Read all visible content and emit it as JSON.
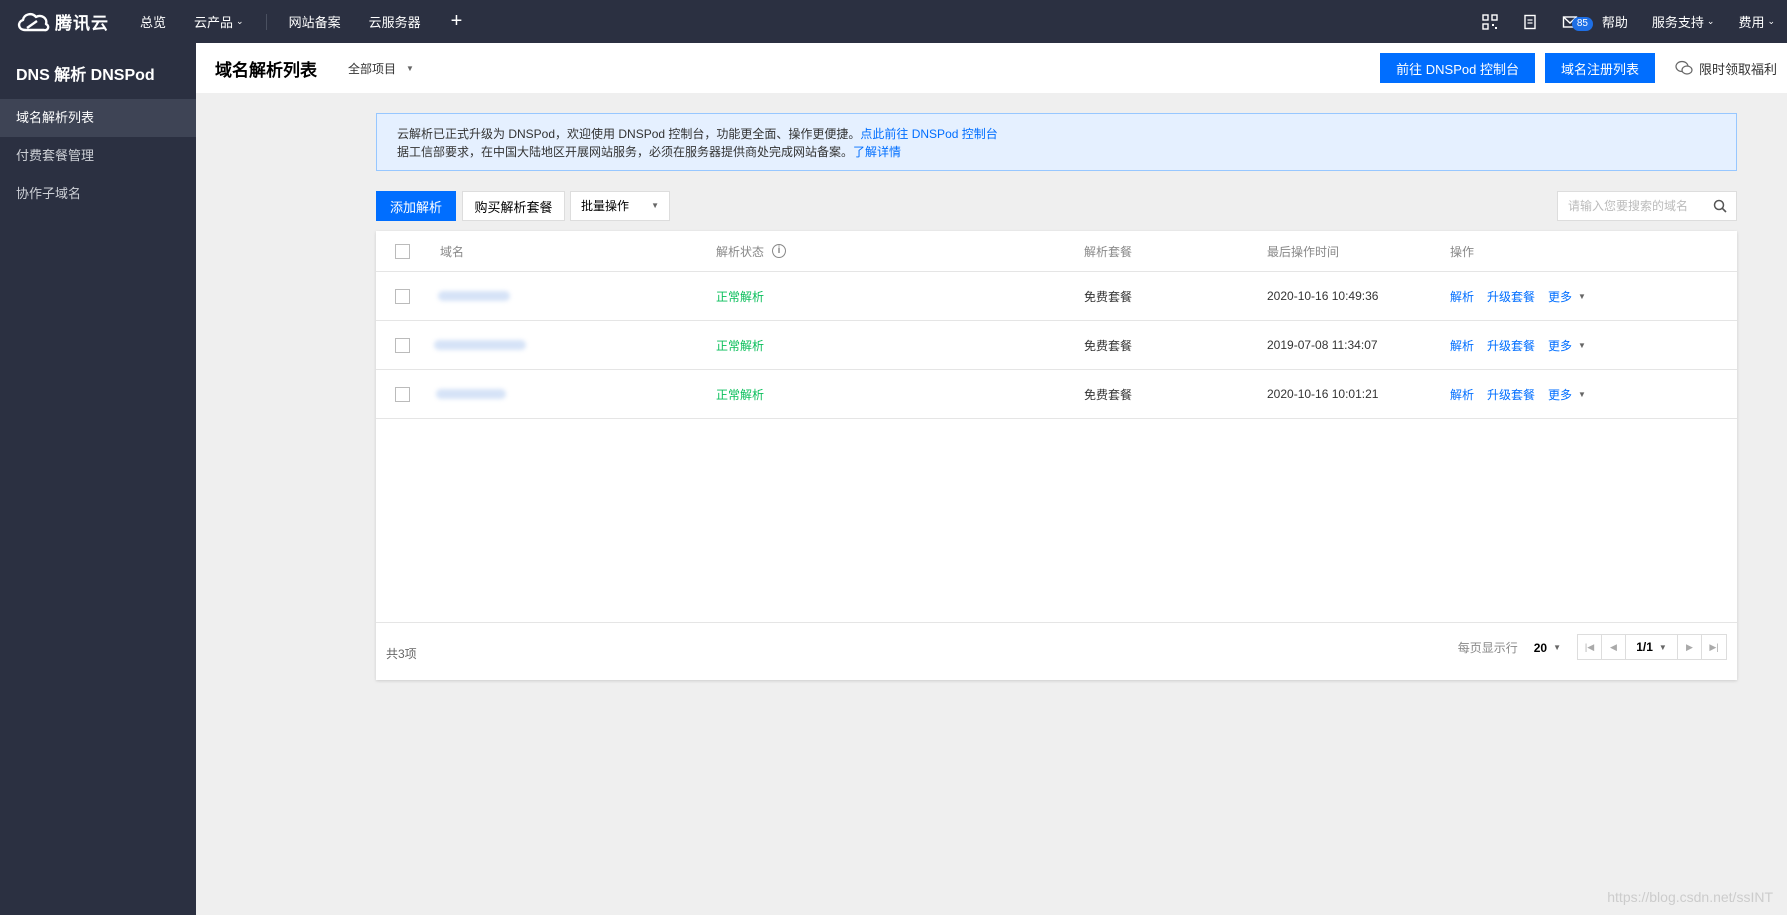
{
  "topbar": {
    "brand": "腾讯云",
    "nav": [
      "总览",
      "云产品",
      "网站备案",
      "云服务器"
    ],
    "plus": "+",
    "badge_count": "85",
    "help": "帮助",
    "support": "服务支持",
    "billing": "费用"
  },
  "sidebar": {
    "title": "DNS 解析 DNSPod",
    "items": [
      {
        "label": "域名解析列表"
      },
      {
        "label": "付费套餐管理"
      },
      {
        "label": "协作子域名"
      }
    ]
  },
  "header": {
    "title": "域名解析列表",
    "project": "全部项目",
    "btn_dnspod": "前往 DNSPod 控制台",
    "btn_register": "域名注册列表",
    "welfare": "限时领取福利"
  },
  "notice": {
    "line1": "云解析已正式升级为 DNSPod，欢迎使用 DNSPod 控制台，功能更全面、操作更便捷。",
    "line1_link": "点此前往 DNSPod 控制台",
    "line2": "据工信部要求，在中国大陆地区开展网站服务，必须在服务器提供商处完成网站备案。",
    "line2_link": "了解详情"
  },
  "toolbar": {
    "add": "添加解析",
    "buy": "购买解析套餐",
    "batch": "批量操作",
    "search_placeholder": "请输入您要搜索的域名"
  },
  "table": {
    "columns": [
      "域名",
      "解析状态",
      "解析套餐",
      "最后操作时间",
      "操作"
    ],
    "rows": [
      {
        "status": "正常解析",
        "plan": "免费套餐",
        "time": "2020-10-16 10:49:36"
      },
      {
        "status": "正常解析",
        "plan": "免费套餐",
        "time": "2019-07-08 11:34:07"
      },
      {
        "status": "正常解析",
        "plan": "免费套餐",
        "time": "2020-10-16 10:01:21"
      }
    ],
    "actions": {
      "resolve": "解析",
      "upgrade": "升级套餐",
      "more": "更多"
    }
  },
  "footer": {
    "total": "共3项",
    "per_page_label": "每页显示行",
    "per_page": "20",
    "page": "1/1"
  },
  "watermark": "https://blog.csdn.net/ssINT"
}
